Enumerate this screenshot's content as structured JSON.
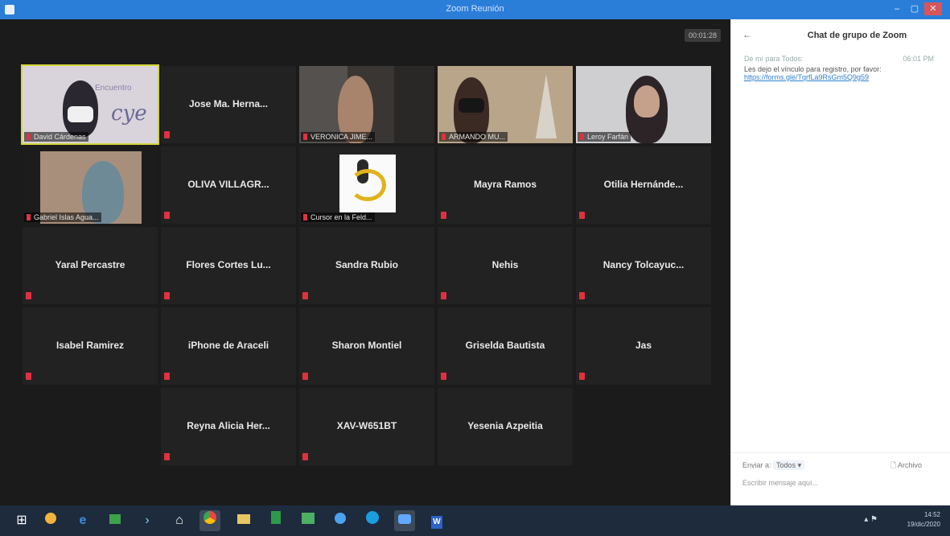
{
  "window": {
    "title": "Zoom Reunión"
  },
  "video": {
    "timer": "00:01:28",
    "video_tiles": [
      {
        "name": "David Cárdenas",
        "highlight": true
      },
      {
        "name": "VERONICA JIME..."
      },
      {
        "name": "ARMANDO MU..."
      },
      {
        "name": "Leroy Farfán"
      },
      {
        "name": "Gabriel Islas Agua..."
      },
      {
        "name": "Cursor en la Feld..."
      }
    ],
    "name_tiles": [
      "Jose Ma. Herna...",
      "OLIVA VILLAGR...",
      "Mayra Ramos",
      "Otilia Hernánde...",
      "Yaral Percastre",
      "Flores Cortes Lu...",
      "Sandra Rubio",
      "Nehis",
      "Nancy Tolcayuc...",
      "Isabel Ramirez",
      "iPhone de Araceli",
      "Sharon Montiel",
      "Griselda Bautista",
      "Jas",
      "Reyna Alicia Her...",
      "XAV-W651BT",
      "Yesenia Azpeitia"
    ]
  },
  "chat": {
    "back_icon": "←",
    "title": "Chat de grupo de Zoom",
    "message": {
      "from": "De mí para Todos:",
      "time": "06:01 PM",
      "text": "Les dejo el vínculo para registro, por favor:",
      "link": "https://forms.gle/TqrfLa9RsGm5Q9g59"
    },
    "to_label": "Enviar a:",
    "to_value": "Todos ▾",
    "file_label": "Archivo",
    "input_placeholder": "Escribir mensaje aquí..."
  },
  "taskbar": {
    "icons": [
      "windows-start-icon",
      "mail-icon",
      "edge-icon",
      "store-icon",
      "terminal-icon",
      "home-icon",
      "chrome-icon",
      "files-icon",
      "excel-icon",
      "paint-icon",
      "zoom-icon",
      "edge-new-icon",
      "zoom-meeting-icon",
      "word-icon"
    ],
    "time": "14:52",
    "date": "19/dic/2020"
  }
}
